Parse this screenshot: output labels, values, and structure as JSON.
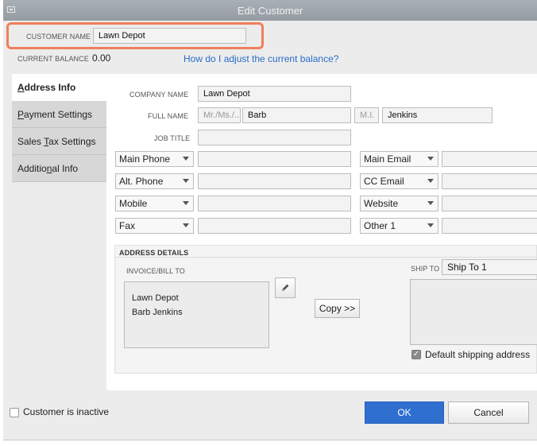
{
  "window": {
    "title": "Edit Customer"
  },
  "customer_name": {
    "label": "CUSTOMER NAME",
    "value": "Lawn Depot"
  },
  "balance": {
    "label": "CURRENT BALANCE",
    "value": "0.00",
    "help_link": "How do I adjust the current balance?"
  },
  "tabs": [
    {
      "pre": "",
      "u": "A",
      "post": "ddress Info"
    },
    {
      "pre": "",
      "u": "P",
      "post": "ayment Settings"
    },
    {
      "pre": "Sales ",
      "u": "T",
      "post": "ax Settings"
    },
    {
      "pre": "Additio",
      "u": "n",
      "post": "al Info"
    }
  ],
  "address_info": {
    "company_name": {
      "label": "COMPANY NAME",
      "value": "Lawn Depot"
    },
    "full_name": {
      "label": "FULL NAME",
      "title_placeholder": "Mr./Ms./...",
      "first": "Barb",
      "mi_placeholder": "M.I.",
      "last": "Jenkins"
    },
    "job_title": {
      "label": "JOB TITLE",
      "value": ""
    },
    "phones": [
      "Main Phone",
      "Alt. Phone",
      "Mobile",
      "Fax"
    ],
    "contacts": [
      "Main Email",
      "CC Email",
      "Website",
      "Other 1"
    ]
  },
  "address_details": {
    "heading": "ADDRESS DETAILS",
    "bill_to_label": "INVOICE/BILL TO",
    "bill_to_lines": [
      "Lawn Depot",
      "Barb Jenkins"
    ],
    "copy_button": "Copy >>",
    "ship_to_label": "SHIP TO",
    "ship_to_select": "Ship To 1",
    "default_shipping": "Default shipping address"
  },
  "footer": {
    "inactive_label": "Customer is inactive",
    "ok": "OK",
    "cancel": "Cancel"
  },
  "colors": {
    "highlight": "#ef7f5a",
    "link": "#2a6cc7",
    "ok": "#2f6fd0"
  },
  "icons": {
    "edit": "pencil-icon"
  }
}
